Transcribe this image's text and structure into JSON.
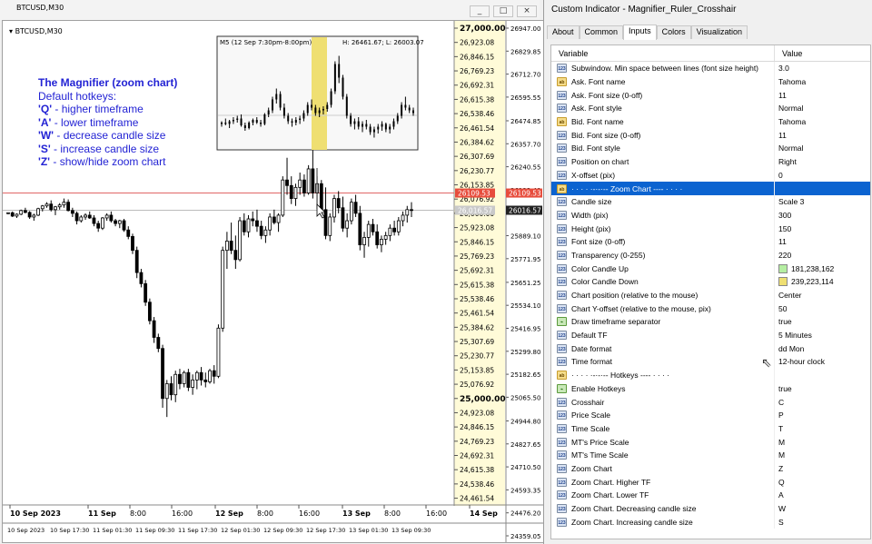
{
  "chart_window": {
    "symbol_title": "BTCUSD,M30",
    "chart_symbol": "BTCUSD,M30",
    "buttons": [
      "_",
      "□",
      "×"
    ],
    "help": {
      "title": "The Magnifier (zoom chart)",
      "subtitle": "Default hotkeys:",
      "lines": [
        {
          "key": "'Q'",
          "text": " - higher timeframe"
        },
        {
          "key": "'A'",
          "text": " - lower timeframe"
        },
        {
          "key": "'W'",
          "text": " - decrease candle size"
        },
        {
          "key": "'S'",
          "text": " - increase candle size"
        },
        {
          "key": "'Z'",
          "text": " - show/hide zoom chart"
        }
      ]
    },
    "zoom_box": {
      "title": "M5 (12 Sep 7:30pm-8:00pm)",
      "hl": "H: 26461.67; L: 26003.07"
    },
    "price_labels": [
      "27,000.00",
      "26,923.08",
      "26,846.15",
      "26,769.23",
      "26,692.31",
      "26,615.38",
      "26,538.46",
      "26,461.54",
      "26,384.62",
      "26,307.69",
      "26,230.77",
      "26,153.85",
      "26,076.92",
      "26,000.00",
      "25,923.08",
      "25,846.15",
      "25,769.23",
      "25,692.31",
      "25,615.38",
      "25,538.46",
      "25,461.54",
      "25,384.62",
      "25,307.69",
      "25,230.77",
      "25,153.85",
      "25,076.92",
      "25,000.00",
      "24,923.08",
      "24,846.15",
      "24,769.23",
      "24,692.31",
      "24,615.38",
      "24,538.46",
      "24,461.54"
    ],
    "right_labels": [
      "26947.00",
      "26829.85",
      "26712.70",
      "26595.55",
      "26474.85",
      "26357.70",
      "26240.55",
      "26123.40",
      "26016.57",
      "25889.10",
      "25771.95",
      "25651.25",
      "25534.10",
      "25416.95",
      "25299.80",
      "25182.65",
      "25065.50",
      "24944.80",
      "24827.65",
      "24710.50",
      "24593.35",
      "24476.20",
      "24359.05"
    ],
    "price_current": "26109.53",
    "price_current_left": "26109.53",
    "price_gray": "26016.57",
    "price_gray_left": "26,016.57",
    "x_labels": [
      "10 Sep 2023",
      "11 Sep",
      "8:00",
      "16:00",
      "12 Sep",
      "8:00",
      "16:00",
      "13 Sep",
      "8:00",
      "16:00",
      "14 Sep"
    ],
    "x_labels_fine": [
      "10 Sep 2023",
      "10 Sep 17:30",
      "11 Sep 01:30",
      "11 Sep 09:30",
      "11 Sep 17:30",
      "12 Sep 01:30",
      "12 Sep 09:30",
      "12 Sep 17:30",
      "13 Sep 01:30",
      "13 Sep 09:30"
    ]
  },
  "dialog": {
    "title": "Custom Indicator - Magnifier_Ruler_Crosshair",
    "tabs": [
      "About",
      "Common",
      "Inputs",
      "Colors",
      "Visualization"
    ],
    "active_tab": "Inputs",
    "columns": [
      "Variable",
      "Value"
    ],
    "rows": [
      {
        "icon": "num",
        "name": "Subwindow. Min space between lines (font size height)",
        "value": "3.0"
      },
      {
        "icon": "ab",
        "name": "Ask. Font name",
        "value": "Tahoma"
      },
      {
        "icon": "num",
        "name": "Ask. Font size (0-off)",
        "value": "11"
      },
      {
        "icon": "num",
        "name": "Ask. Font style",
        "value": "Normal"
      },
      {
        "icon": "ab",
        "name": "Bid. Font name",
        "value": "Tahoma"
      },
      {
        "icon": "num",
        "name": "Bid. Font size (0-off)",
        "value": "11"
      },
      {
        "icon": "num",
        "name": "Bid. Font style",
        "value": "Normal"
      },
      {
        "icon": "num",
        "name": "Position on chart",
        "value": "Right"
      },
      {
        "icon": "num",
        "name": "X-offset (pix)",
        "value": "0"
      },
      {
        "icon": "ab",
        "name": "·  ·  ·  ·  ·-·-·-- Zoom Chart ---- ·  ·  ·  ·",
        "value": "",
        "selected": true
      },
      {
        "icon": "num",
        "name": "Candle size",
        "value": "Scale 3"
      },
      {
        "icon": "num",
        "name": "Width (pix)",
        "value": "300"
      },
      {
        "icon": "num",
        "name": "Height (pix)",
        "value": "150"
      },
      {
        "icon": "num",
        "name": "Font size (0-off)",
        "value": "11"
      },
      {
        "icon": "num",
        "name": "Transparency (0-255)",
        "value": "220"
      },
      {
        "icon": "num",
        "name": "Color Candle Up",
        "value": "181,238,162",
        "swatch": "#b5eea2"
      },
      {
        "icon": "num",
        "name": "Color Candle Down",
        "value": "239,223,114",
        "swatch": "#efdf72"
      },
      {
        "icon": "num",
        "name": "Chart position (relative to the mouse)",
        "value": "Center"
      },
      {
        "icon": "num",
        "name": "Chart Y-offset (relative to the mouse, pix)",
        "value": "50"
      },
      {
        "icon": "flag",
        "name": "Draw timeframe separator",
        "value": "true"
      },
      {
        "icon": "num",
        "name": "Default TF",
        "value": "5 Minutes"
      },
      {
        "icon": "num",
        "name": "Date format",
        "value": "dd Mon"
      },
      {
        "icon": "num",
        "name": "Time format",
        "value": "12-hour clock"
      },
      {
        "icon": "ab",
        "name": "·  ·  ·  ·  ·-·-·-- Hotkeys ---- ·  ·  ·  ·",
        "value": ""
      },
      {
        "icon": "flag",
        "name": "Enable Hotkeys",
        "value": "true"
      },
      {
        "icon": "num",
        "name": "Crosshair",
        "value": "C"
      },
      {
        "icon": "num",
        "name": "Price Scale",
        "value": "P"
      },
      {
        "icon": "num",
        "name": "Time Scale",
        "value": "T"
      },
      {
        "icon": "num",
        "name": "MT's Price Scale",
        "value": "M"
      },
      {
        "icon": "num",
        "name": "MT's Time Scale",
        "value": "M"
      },
      {
        "icon": "num",
        "name": "Zoom Chart",
        "value": "Z"
      },
      {
        "icon": "num",
        "name": "Zoom Chart. Higher TF",
        "value": "Q"
      },
      {
        "icon": "num",
        "name": "Zoom Chart. Lower TF",
        "value": "A"
      },
      {
        "icon": "num",
        "name": "Zoom Chart. Decreasing candle size",
        "value": "W"
      },
      {
        "icon": "num",
        "name": "Zoom Chart. Increasing candle size",
        "value": "S"
      }
    ]
  },
  "candles": [
    [
      26000,
      26005,
      25995,
      26003
    ],
    [
      26003,
      26010,
      25980,
      25985
    ],
    [
      25985,
      26000,
      25975,
      25995
    ],
    [
      25995,
      26020,
      25990,
      26015
    ],
    [
      26015,
      26030,
      26000,
      26005
    ],
    [
      26005,
      26012,
      25970,
      25980
    ],
    [
      25980,
      25998,
      25960,
      25990
    ],
    [
      25990,
      26030,
      25985,
      26025
    ],
    [
      26025,
      26045,
      26010,
      26040
    ],
    [
      26040,
      26060,
      26030,
      26050
    ],
    [
      26050,
      26070,
      26010,
      26020
    ],
    [
      26020,
      26040,
      25990,
      26035
    ],
    [
      26035,
      26055,
      26020,
      26045
    ],
    [
      26045,
      26080,
      26030,
      26060
    ],
    [
      26060,
      26075,
      26010,
      26015
    ],
    [
      26015,
      26030,
      25980,
      26000
    ],
    [
      26000,
      26010,
      25940,
      25960
    ],
    [
      25960,
      25990,
      25950,
      25980
    ],
    [
      25980,
      26000,
      25965,
      25990
    ],
    [
      25990,
      26010,
      25970,
      25975
    ],
    [
      25975,
      25990,
      25930,
      25945
    ],
    [
      25945,
      25960,
      25900,
      25920
    ],
    [
      25920,
      25980,
      25910,
      25975
    ],
    [
      25975,
      26000,
      25960,
      25990
    ],
    [
      25990,
      26010,
      25950,
      25960
    ],
    [
      25960,
      25970,
      25930,
      25945
    ],
    [
      25945,
      25965,
      25920,
      25960
    ],
    [
      25960,
      25970,
      25900,
      25910
    ],
    [
      25910,
      25930,
      25860,
      25875
    ],
    [
      25875,
      25890,
      25780,
      25800
    ],
    [
      25800,
      25820,
      25650,
      25680
    ],
    [
      25680,
      25700,
      25600,
      25620
    ],
    [
      25620,
      25640,
      25500,
      25520
    ],
    [
      25520,
      25540,
      25400,
      25420
    ],
    [
      25420,
      25440,
      25300,
      25330
    ],
    [
      25330,
      25350,
      25250,
      25270
    ],
    [
      25270,
      25290,
      24950,
      25000
    ],
    [
      25000,
      25100,
      24900,
      25080
    ],
    [
      25080,
      25120,
      24990,
      25020
    ],
    [
      25020,
      25150,
      24980,
      25130
    ],
    [
      25130,
      25160,
      25050,
      25080
    ],
    [
      25080,
      25150,
      25060,
      25140
    ],
    [
      25140,
      25160,
      25040,
      25060
    ],
    [
      25060,
      25130,
      25020,
      25100
    ],
    [
      25100,
      25150,
      25050,
      25140
    ],
    [
      25140,
      25170,
      25070,
      25100
    ],
    [
      25100,
      25140,
      25060,
      25090
    ],
    [
      25090,
      25160,
      25080,
      25150
    ],
    [
      25150,
      25180,
      25080,
      25120
    ],
    [
      25120,
      25400,
      25110,
      25380
    ],
    [
      25380,
      25820,
      25360,
      25800
    ],
    [
      25800,
      25900,
      25700,
      25850
    ],
    [
      25850,
      25950,
      25780,
      25800
    ],
    [
      25800,
      25880,
      25700,
      25750
    ],
    [
      25750,
      25980,
      25740,
      25960
    ],
    [
      25960,
      26000,
      25880,
      25900
    ],
    [
      25900,
      25990,
      25870,
      25970
    ],
    [
      25970,
      26010,
      25930,
      25960
    ],
    [
      25960,
      26020,
      25900,
      25930
    ],
    [
      25930,
      25960,
      25860,
      25880
    ],
    [
      25880,
      25930,
      25840,
      25910
    ],
    [
      25910,
      26000,
      25880,
      25980
    ],
    [
      25980,
      26020,
      25940,
      25950
    ],
    [
      25950,
      26000,
      25900,
      25990
    ],
    [
      25990,
      26200,
      25980,
      26180
    ],
    [
      26180,
      26300,
      26100,
      26150
    ],
    [
      26150,
      26200,
      26050,
      26080
    ],
    [
      26080,
      26160,
      26040,
      26140
    ],
    [
      26140,
      26220,
      26100,
      26180
    ],
    [
      26180,
      26210,
      26090,
      26110
    ],
    [
      26110,
      26260,
      26100,
      26240
    ],
    [
      26240,
      26400,
      26080,
      26110
    ],
    [
      26110,
      26200,
      26030,
      26160
    ],
    [
      26160,
      26180,
      26000,
      26020
    ],
    [
      26020,
      26140,
      25860,
      25880
    ],
    [
      25880,
      26000,
      25850,
      25980
    ],
    [
      25980,
      26100,
      25950,
      26080
    ],
    [
      26080,
      26120,
      26000,
      26030
    ],
    [
      26030,
      26090,
      25900,
      25920
    ],
    [
      25920,
      26000,
      25870,
      25960
    ],
    [
      25960,
      26080,
      25940,
      26060
    ],
    [
      26060,
      26100,
      25980,
      26000
    ],
    [
      26000,
      26040,
      25800,
      25830
    ],
    [
      25830,
      25900,
      25760,
      25870
    ],
    [
      25870,
      25960,
      25820,
      25940
    ],
    [
      25940,
      25970,
      25880,
      25900
    ],
    [
      25900,
      25940,
      25810,
      25830
    ],
    [
      25830,
      25880,
      25790,
      25860
    ],
    [
      25860,
      25900,
      25830,
      25880
    ],
    [
      25880,
      25940,
      25850,
      25920
    ],
    [
      25920,
      25960,
      25880,
      25900
    ],
    [
      25900,
      25980,
      25880,
      25960
    ],
    [
      25960,
      26010,
      25930,
      25990
    ],
    [
      25990,
      26040,
      25950,
      26020
    ],
    [
      26020,
      26060,
      25980,
      26016
    ]
  ],
  "zoom_candles": [
    [
      40,
      42,
      38,
      41
    ],
    [
      41,
      44,
      39,
      40
    ],
    [
      40,
      43,
      37,
      42
    ],
    [
      42,
      45,
      40,
      43
    ],
    [
      43,
      46,
      41,
      44
    ],
    [
      44,
      47,
      38,
      39
    ],
    [
      39,
      41,
      35,
      37
    ],
    [
      37,
      42,
      36,
      41
    ],
    [
      41,
      44,
      39,
      43
    ],
    [
      43,
      45,
      40,
      41
    ],
    [
      41,
      43,
      38,
      40
    ],
    [
      40,
      48,
      39,
      47
    ],
    [
      47,
      52,
      45,
      50
    ],
    [
      50,
      60,
      48,
      58
    ],
    [
      58,
      66,
      55,
      62
    ],
    [
      62,
      64,
      50,
      52
    ],
    [
      52,
      55,
      44,
      46
    ],
    [
      46,
      48,
      40,
      42
    ],
    [
      42,
      44,
      38,
      41
    ],
    [
      41,
      45,
      39,
      43
    ],
    [
      43,
      46,
      40,
      44
    ],
    [
      44,
      50,
      42,
      48
    ],
    [
      48,
      56,
      46,
      54
    ],
    [
      54,
      58,
      50,
      52
    ],
    [
      52,
      54,
      46,
      48
    ],
    [
      48,
      52,
      45,
      50
    ],
    [
      50,
      53,
      47,
      51
    ],
    [
      51,
      56,
      49,
      54
    ],
    [
      54,
      66,
      52,
      64
    ],
    [
      64,
      86,
      62,
      84
    ],
    [
      84,
      90,
      70,
      74
    ],
    [
      74,
      76,
      58,
      60
    ],
    [
      60,
      62,
      44,
      46
    ],
    [
      46,
      48,
      38,
      40
    ],
    [
      40,
      44,
      36,
      42
    ],
    [
      42,
      45,
      36,
      38
    ],
    [
      38,
      42,
      34,
      40
    ],
    [
      40,
      43,
      36,
      38
    ],
    [
      38,
      40,
      32,
      34
    ],
    [
      34,
      38,
      30,
      36
    ],
    [
      36,
      40,
      33,
      38
    ],
    [
      38,
      42,
      35,
      40
    ],
    [
      40,
      41,
      34,
      36
    ],
    [
      36,
      40,
      33,
      38
    ],
    [
      38,
      44,
      36,
      42
    ],
    [
      42,
      48,
      40,
      46
    ],
    [
      46,
      56,
      44,
      54
    ],
    [
      54,
      60,
      50,
      52
    ],
    [
      52,
      54,
      48,
      50
    ],
    [
      50,
      52,
      46,
      48
    ]
  ]
}
